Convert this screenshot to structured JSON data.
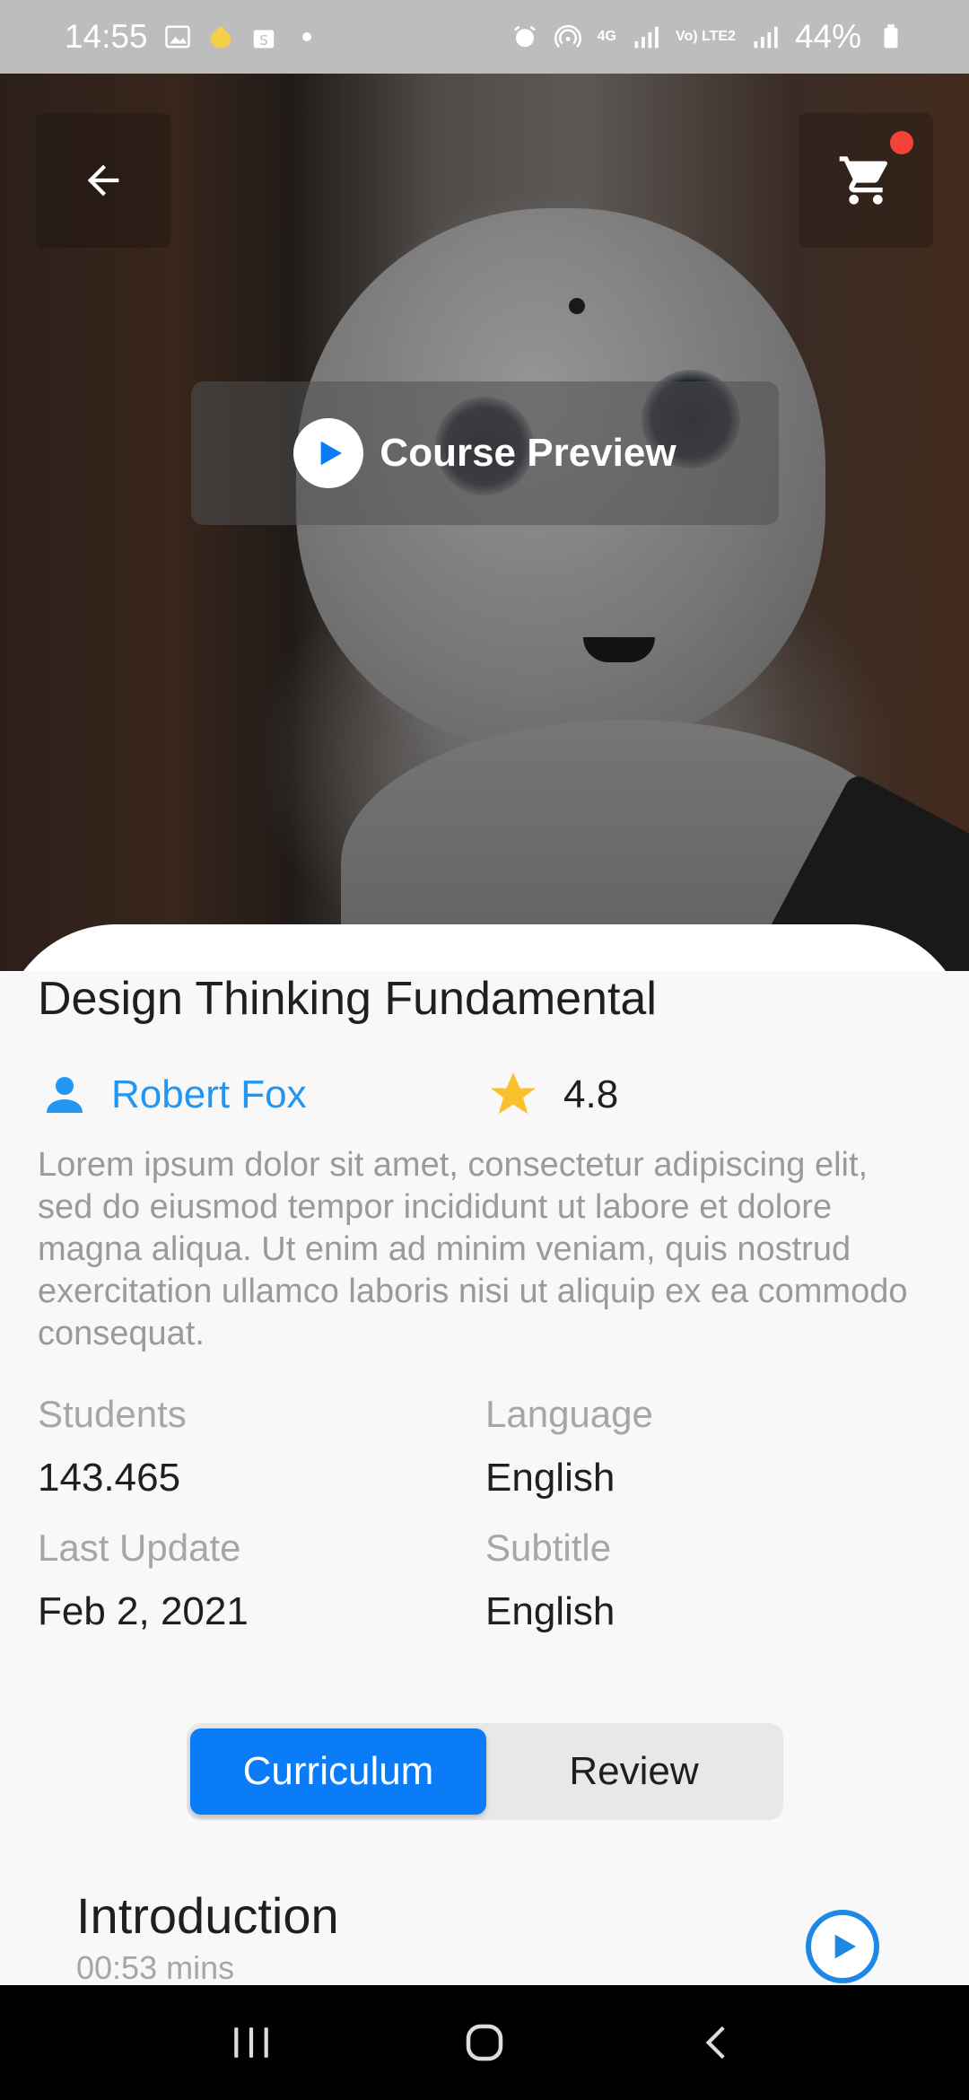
{
  "status_bar": {
    "time": "14:55",
    "battery": "44%",
    "network_4g": "4G",
    "network_volte": "Vo) LTE2"
  },
  "hero": {
    "preview_label": "Course Preview",
    "cart_has_badge": true
  },
  "course": {
    "title": "Design Thinking Fundamental",
    "author": "Robert Fox",
    "rating": "4.8",
    "description": "Lorem ipsum dolor sit amet, consectetur adipiscing elit, sed do eiusmod tempor incididunt ut labore et dolore magna aliqua. Ut enim ad minim veniam, quis nostrud exercitation ullamco laboris nisi ut aliquip ex ea commodo consequat."
  },
  "info": {
    "students_label": "Students",
    "students_value": "143.465",
    "language_label": "Language",
    "language_value": "English",
    "last_update_label": "Last Update",
    "last_update_value": "Feb 2, 2021",
    "subtitle_label": "Subtitle",
    "subtitle_value": "English"
  },
  "tabs": {
    "active": "Curriculum",
    "inactive": "Review"
  },
  "lesson": {
    "title": "Introduction",
    "duration": "00:53 mins"
  },
  "colors": {
    "accent": "#0a7cf7",
    "author_link": "#2196f3",
    "star": "#fbc02d",
    "badge": "#f44336"
  }
}
